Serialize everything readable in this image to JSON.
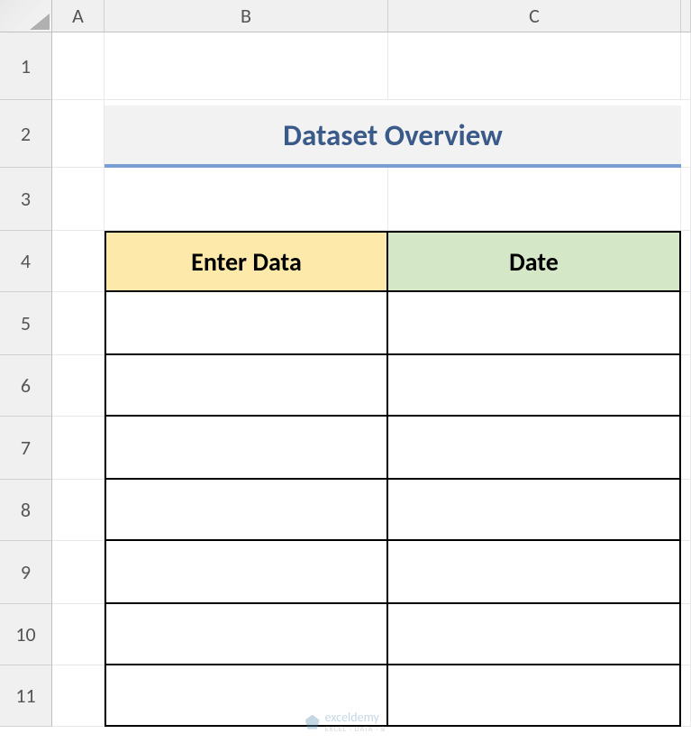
{
  "columns": [
    "A",
    "B",
    "C"
  ],
  "rows": [
    "1",
    "2",
    "3",
    "4",
    "5",
    "6",
    "7",
    "8",
    "9",
    "10",
    "11"
  ],
  "title": "Dataset Overview",
  "headers": {
    "col_b": "Enter Data",
    "col_c": "Date"
  },
  "watermark": {
    "brand": "exceldemy",
    "tagline": "EXCEL · DATA · B"
  }
}
